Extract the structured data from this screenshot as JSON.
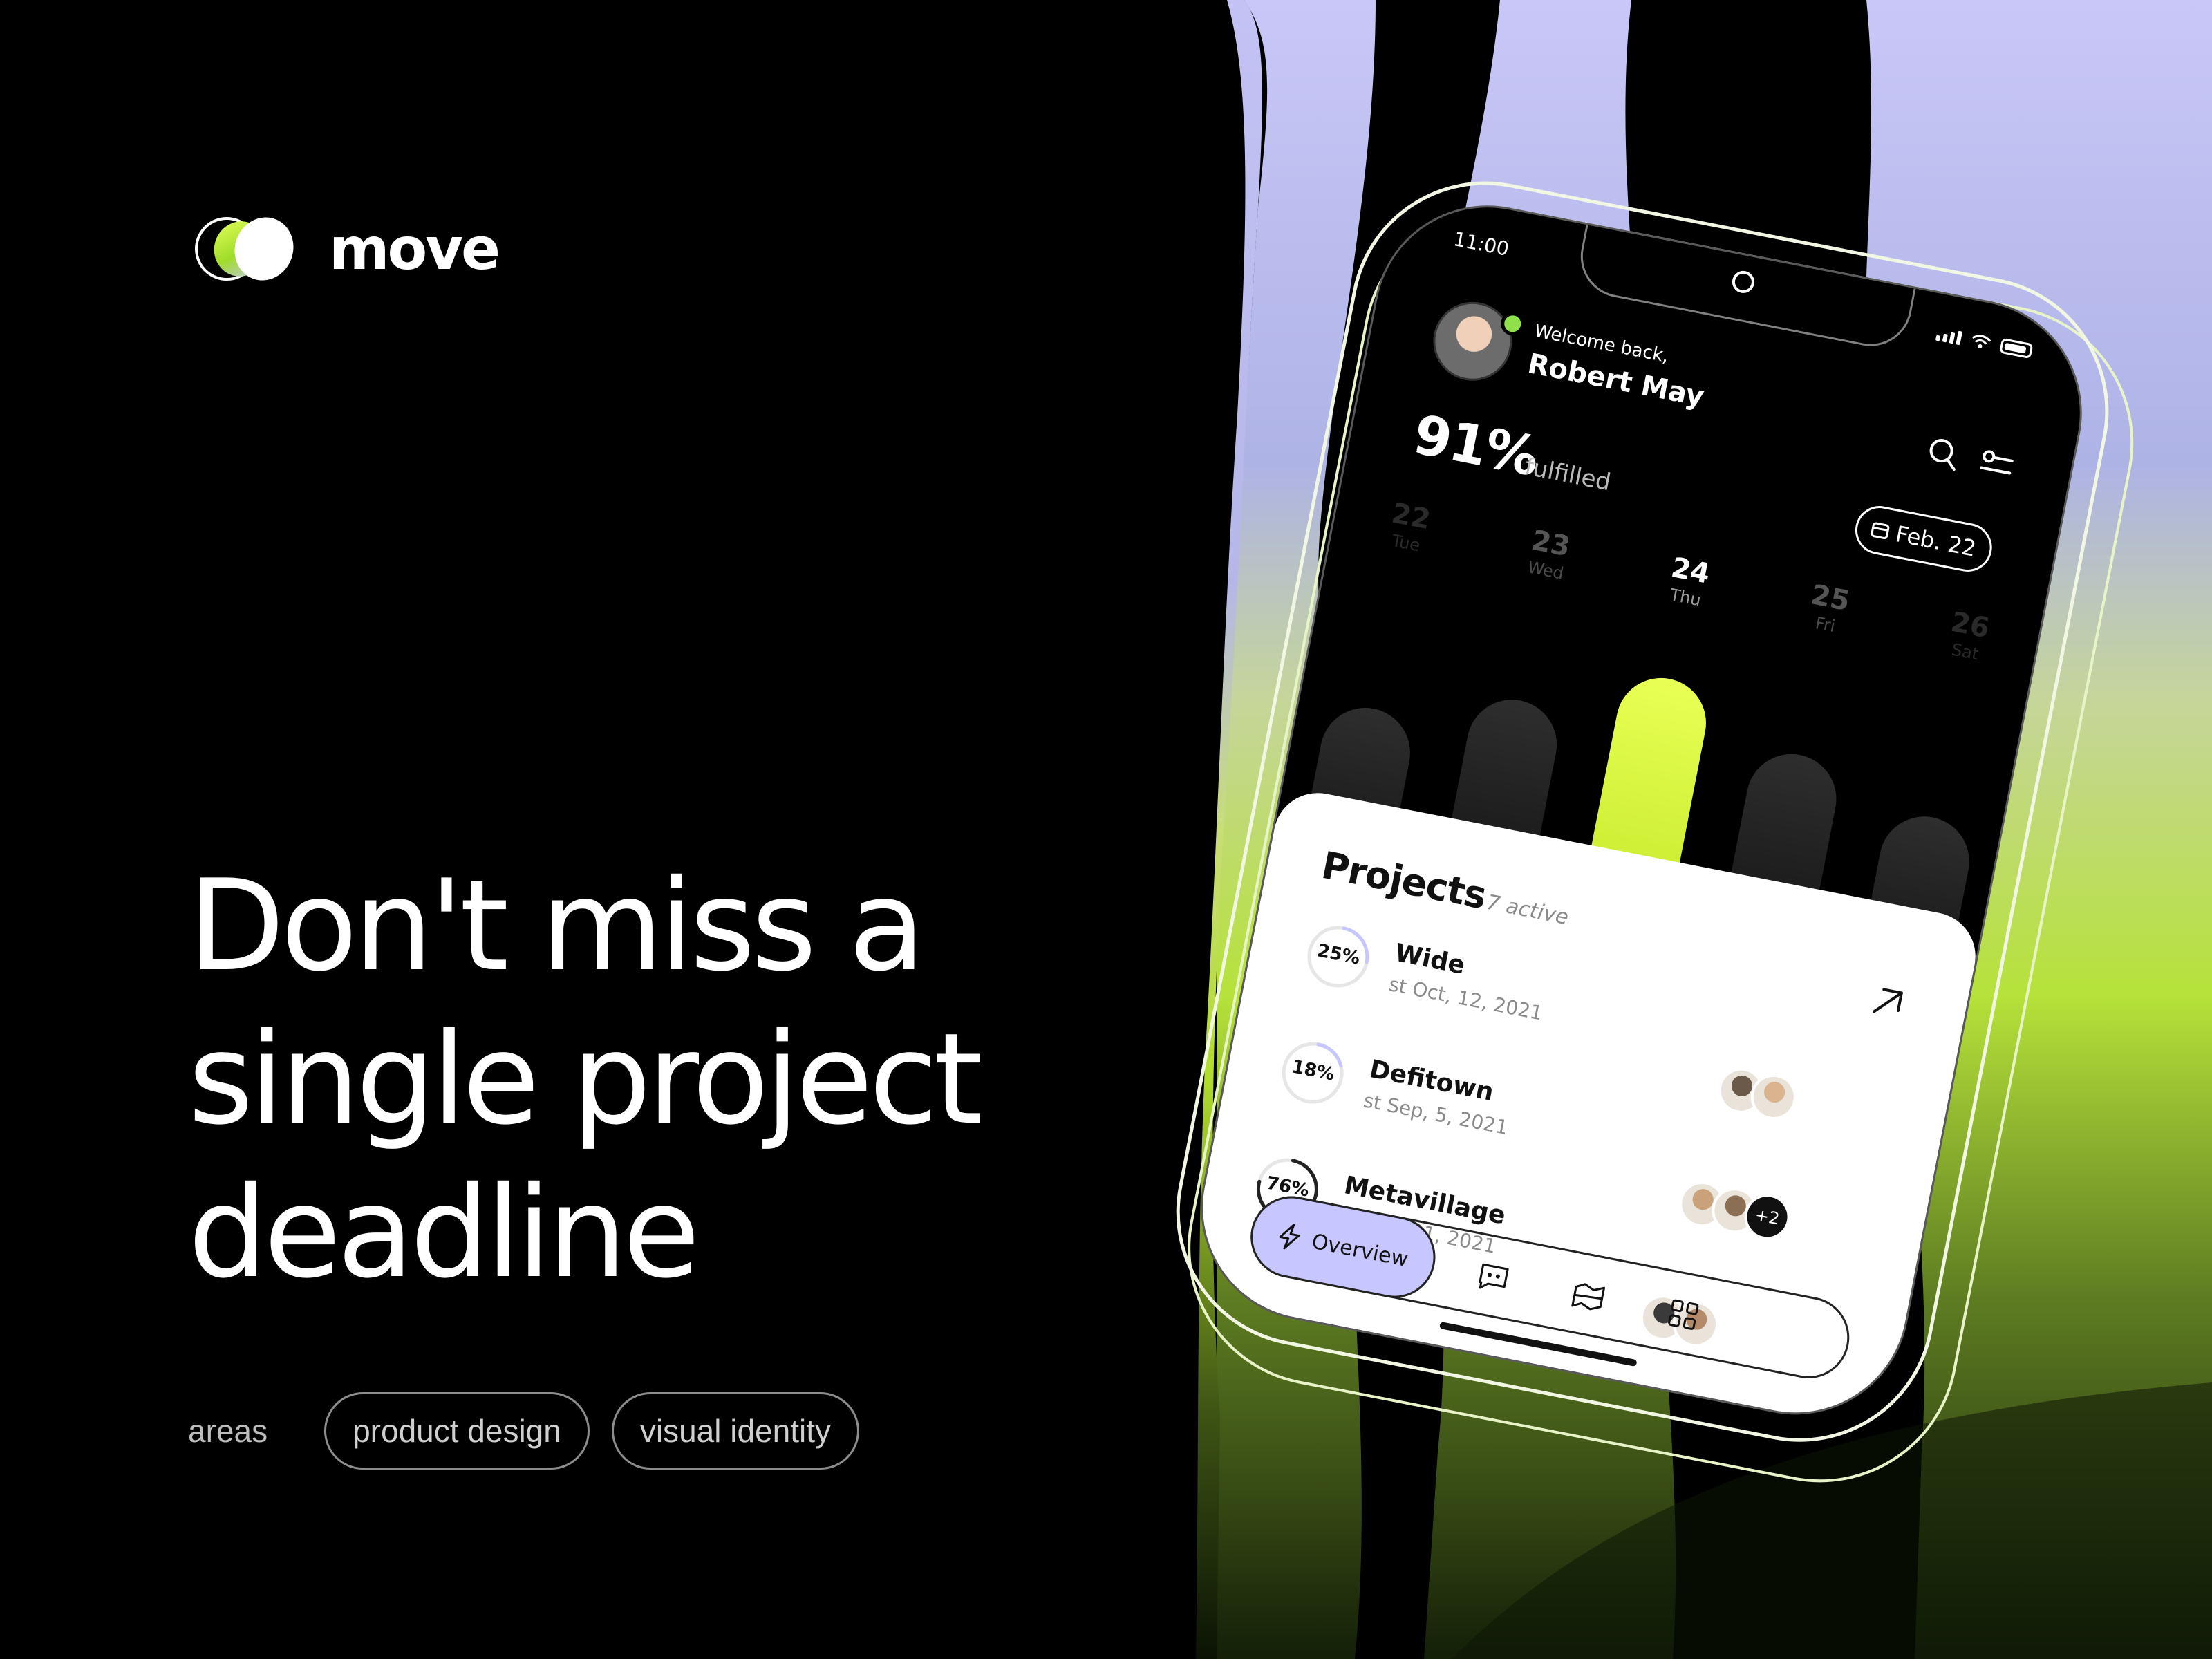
{
  "brand": {
    "name": "move"
  },
  "hero": {
    "headline_lines": [
      "Don't miss a",
      "single project",
      "deadline"
    ]
  },
  "areas": {
    "label": "areas",
    "tags": [
      "product design",
      "visual identity"
    ]
  },
  "phone": {
    "status": {
      "time": "11:00"
    },
    "header": {
      "welcome": "Welcome back,",
      "user_name": "Robert May"
    },
    "summary": {
      "percent": "91%",
      "percent_label": "fulfilled",
      "date_pill": "Feb. 22"
    },
    "days": [
      {
        "num": "22",
        "name": "Tue",
        "level": 0.68
      },
      {
        "num": "23",
        "name": "Wed",
        "level": 0.78
      },
      {
        "num": "24",
        "name": "Thu",
        "level": 0.92,
        "active": true
      },
      {
        "num": "25",
        "name": "Fri",
        "level": 0.78
      },
      {
        "num": "26",
        "name": "Sat",
        "level": 0.68
      }
    ],
    "projects": {
      "title": "Projects",
      "count": "7 active",
      "items": [
        {
          "percent_label": "25%",
          "progress": 0.25,
          "name": "Wide",
          "date": "st Oct, 12, 2021",
          "team_more": ""
        },
        {
          "percent_label": "18%",
          "progress": 0.18,
          "name": "Defitown",
          "date": "st Sep, 5, 2021",
          "team_more": "+2"
        },
        {
          "percent_label": "76%",
          "progress": 0.76,
          "name": "Metavillage",
          "date": "st Aug, 21, 2021",
          "team_more": ""
        }
      ]
    },
    "tabbar": {
      "overview_label": "Overview",
      "icons": [
        "chat-icon",
        "map-icon",
        "grid-icon"
      ]
    }
  },
  "colors": {
    "accent_lime": "#d4f53c",
    "accent_lavender": "#c8c6ff",
    "background": "#000000"
  }
}
